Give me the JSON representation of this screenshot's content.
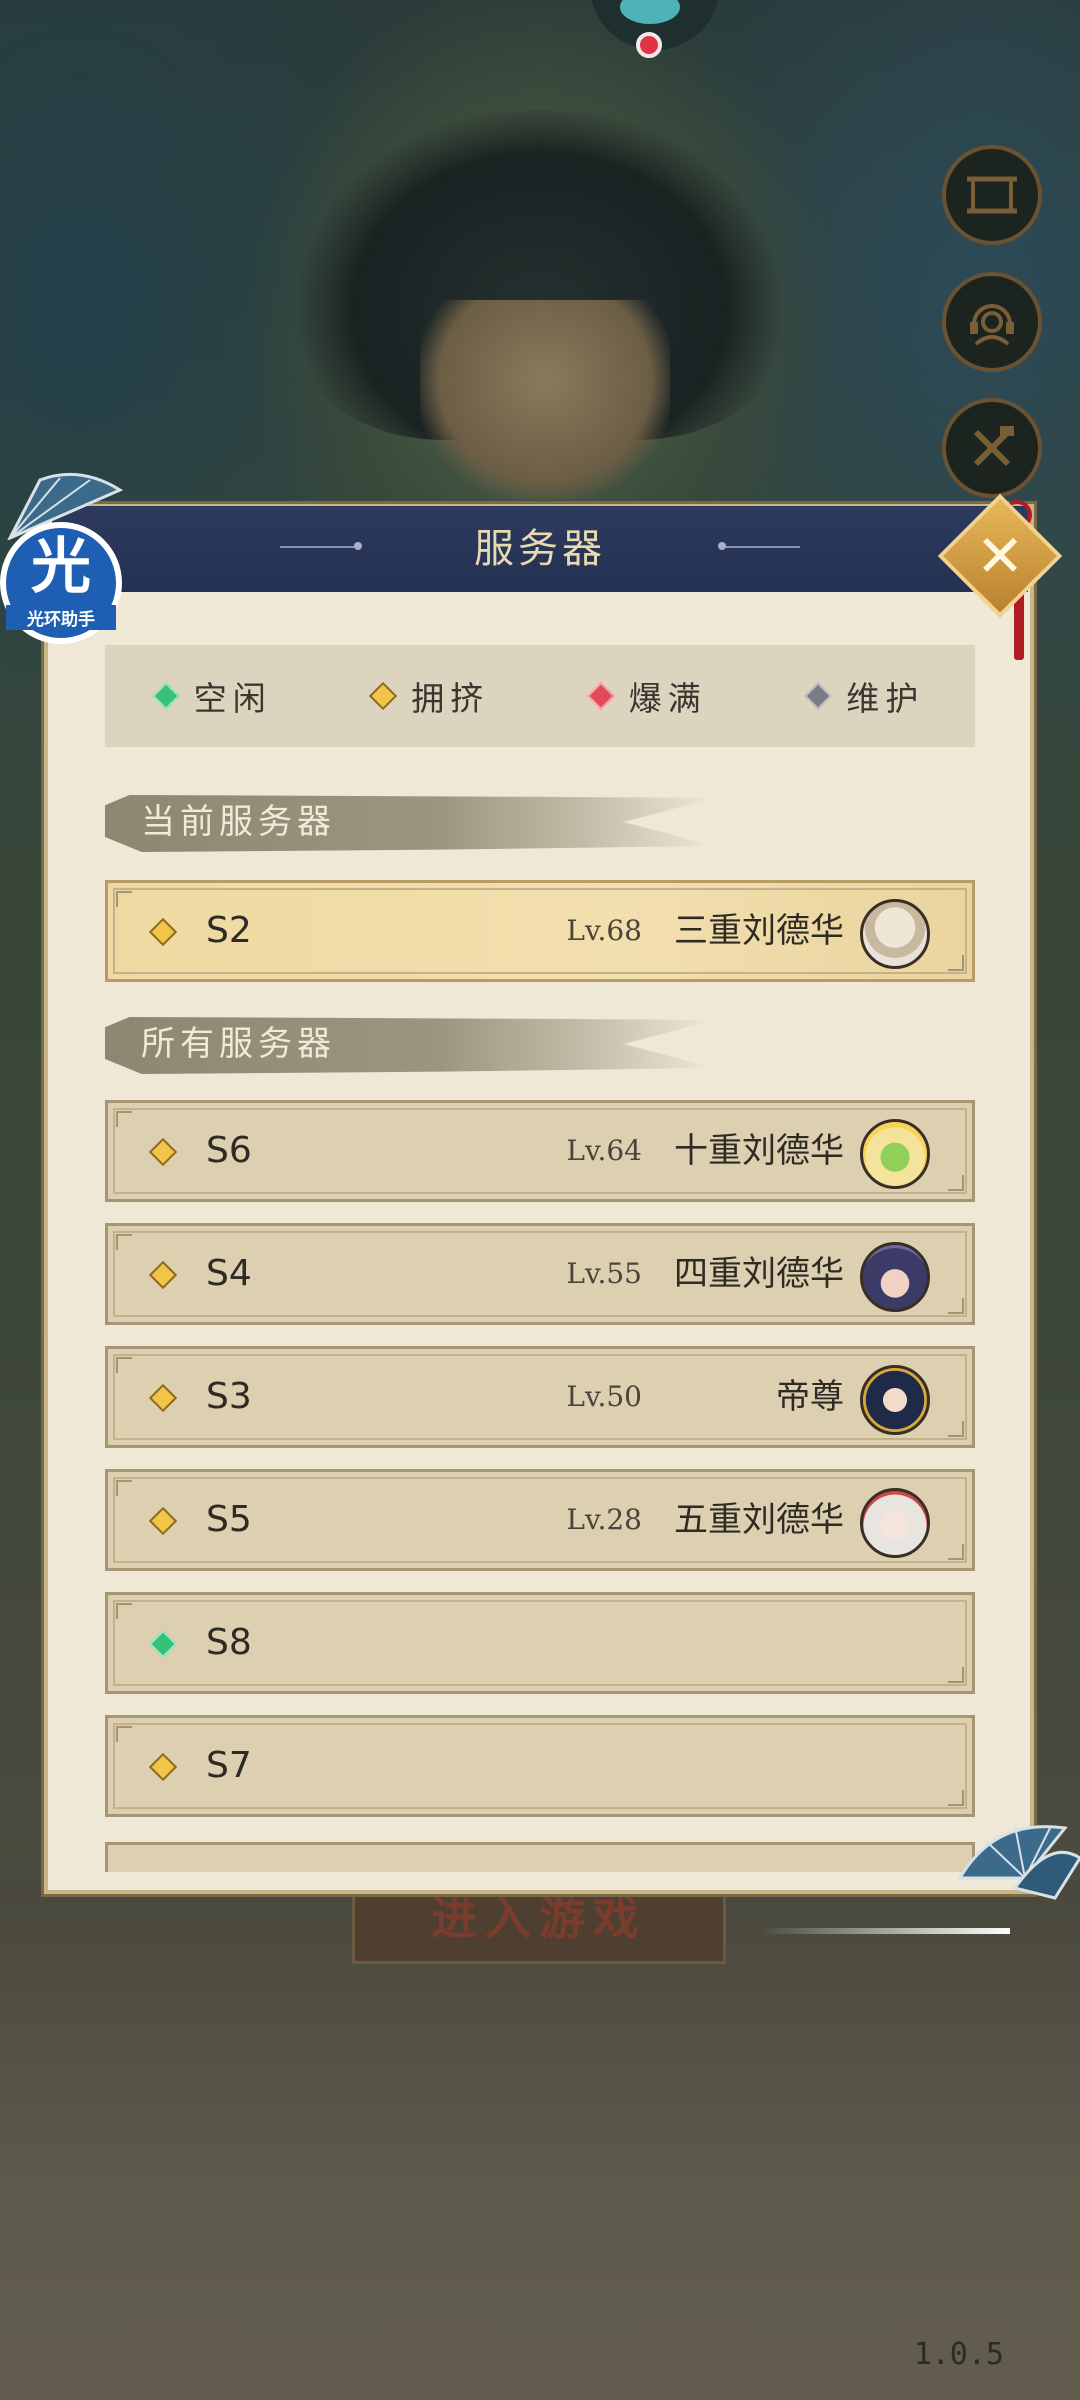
{
  "assistant_badge": {
    "big_char": "光",
    "label": "光环助手"
  },
  "dialog": {
    "title": "服务器",
    "close_label": "✕"
  },
  "legend": [
    {
      "label": "空闲",
      "status": "idle",
      "color": "#36c07a"
    },
    {
      "label": "拥挤",
      "status": "crowded",
      "color": "#f0c54a"
    },
    {
      "label": "爆满",
      "status": "full",
      "color": "#e24b55"
    },
    {
      "label": "维护",
      "status": "maintenance",
      "color": "#7a7d86"
    }
  ],
  "sections": {
    "current": "当前服务器",
    "all": "所有服务器"
  },
  "current_server": {
    "name": "S2",
    "status": "crowded",
    "level": "Lv.68",
    "player": "三重刘德华"
  },
  "servers": [
    {
      "name": "S6",
      "status": "crowded",
      "level": "Lv.64",
      "player": "十重刘德华"
    },
    {
      "name": "S4",
      "status": "crowded",
      "level": "Lv.55",
      "player": "四重刘德华"
    },
    {
      "name": "S3",
      "status": "crowded",
      "level": "Lv.50",
      "player": "帝尊"
    },
    {
      "name": "S5",
      "status": "crowded",
      "level": "Lv.28",
      "player": "五重刘德华"
    },
    {
      "name": "S8",
      "status": "idle",
      "level": "",
      "player": ""
    },
    {
      "name": "S7",
      "status": "crowded",
      "level": "",
      "player": ""
    }
  ],
  "background": {
    "enter_button": "进入游戏",
    "version": "1.0.5"
  },
  "side_icons": [
    "scroll-icon",
    "support-headset-icon",
    "tools-icon"
  ]
}
